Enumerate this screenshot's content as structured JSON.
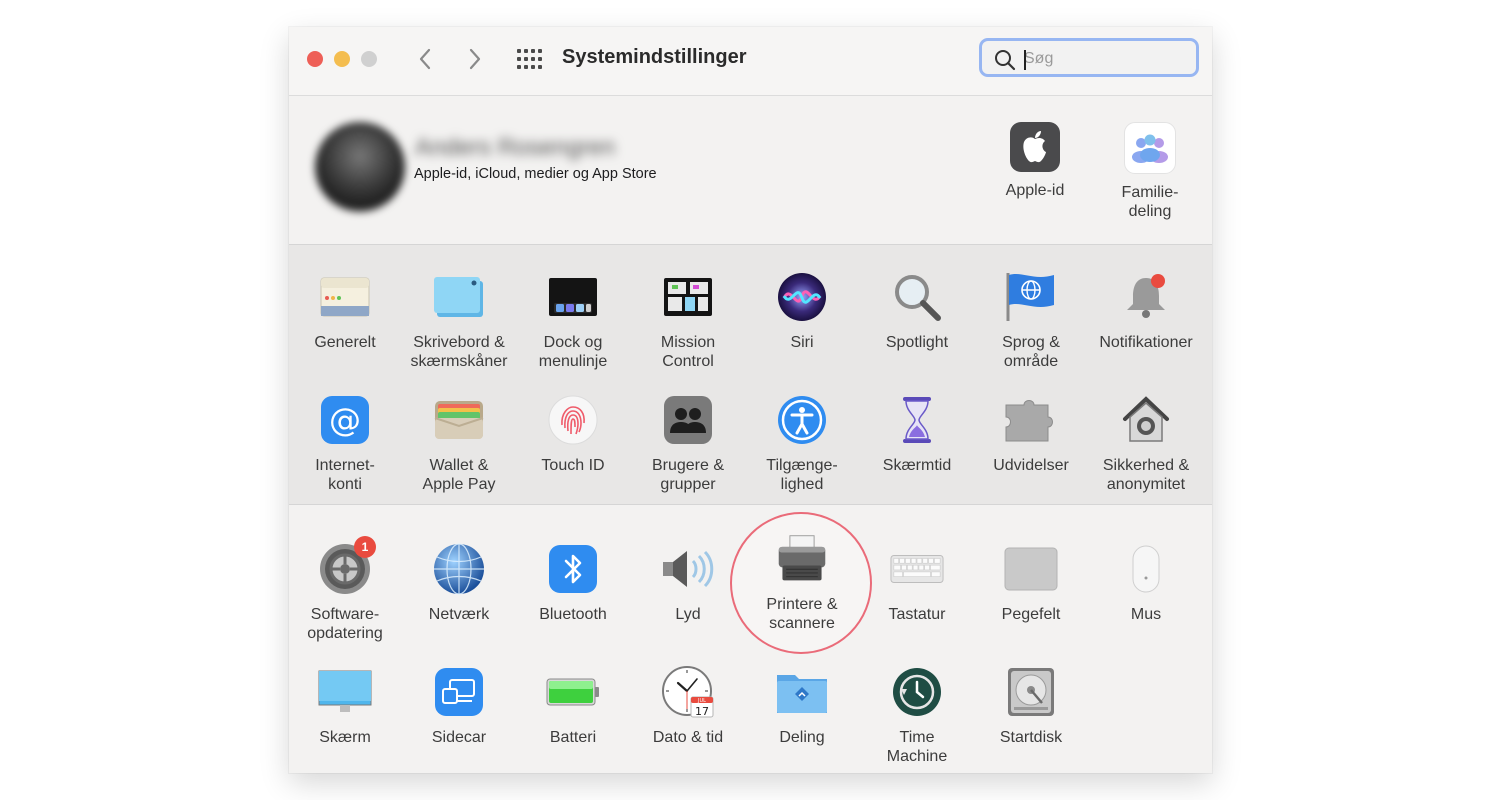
{
  "window": {
    "title": "Systemindstillinger",
    "search": {
      "placeholder": "Søg",
      "value": ""
    }
  },
  "account": {
    "name": "Anders Rosengren",
    "subtitle": "Apple-id, iCloud, medier og App Store",
    "items": [
      {
        "label": "Apple-id",
        "icon": "apple-icon"
      },
      {
        "label": "Familie-\ndeling",
        "icon": "family-icon"
      }
    ]
  },
  "section1": {
    "row1": [
      {
        "label": "Generelt",
        "icon": "general-icon"
      },
      {
        "label": "Skrivebord &\nskærmskåner",
        "icon": "desktop-icon"
      },
      {
        "label": "Dock og\nmenulinje",
        "icon": "dock-icon"
      },
      {
        "label": "Mission\nControl",
        "icon": "mission-control-icon"
      },
      {
        "label": "Siri",
        "icon": "siri-icon"
      },
      {
        "label": "Spotlight",
        "icon": "spotlight-icon"
      },
      {
        "label": "Sprog &\nområde",
        "icon": "language-flag-icon"
      },
      {
        "label": "Notifikationer",
        "icon": "bell-icon"
      }
    ],
    "row2": [
      {
        "label": "Internet-\nkonti",
        "icon": "at-sign-icon"
      },
      {
        "label": "Wallet &\nApple Pay",
        "icon": "wallet-icon"
      },
      {
        "label": "Touch ID",
        "icon": "fingerprint-icon"
      },
      {
        "label": "Brugere &\ngrupper",
        "icon": "users-icon"
      },
      {
        "label": "Tilgænge-\nlighed",
        "icon": "accessibility-icon"
      },
      {
        "label": "Skærmtid",
        "icon": "hourglass-icon"
      },
      {
        "label": "Udvidelser",
        "icon": "puzzle-icon"
      },
      {
        "label": "Sikkerhed &\nanonymitet",
        "icon": "house-lock-icon"
      }
    ]
  },
  "section2": {
    "row1": [
      {
        "label": "Software-\nopdatering",
        "icon": "gear-icon",
        "badge": "1"
      },
      {
        "label": "Netværk",
        "icon": "globe-icon"
      },
      {
        "label": "Bluetooth",
        "icon": "bluetooth-icon"
      },
      {
        "label": "Lyd",
        "icon": "speaker-icon"
      },
      {
        "label": "Printere &\nscannere",
        "icon": "printer-icon"
      },
      {
        "label": "Tastatur",
        "icon": "keyboard-icon"
      },
      {
        "label": "Pegefelt",
        "icon": "trackpad-icon"
      },
      {
        "label": "Mus",
        "icon": "mouse-icon"
      }
    ],
    "row2": [
      {
        "label": "Skærm",
        "icon": "display-icon"
      },
      {
        "label": "Sidecar",
        "icon": "sidecar-icon"
      },
      {
        "label": "Batteri",
        "icon": "battery-icon"
      },
      {
        "label": "Dato & tid",
        "icon": "clock-icon",
        "date_day": "17",
        "date_month": "JUL"
      },
      {
        "label": "Deling",
        "icon": "sharing-folder-icon"
      },
      {
        "label": "Time\nMachine",
        "icon": "time-machine-icon"
      },
      {
        "label": "Startdisk",
        "icon": "disk-icon"
      }
    ]
  }
}
